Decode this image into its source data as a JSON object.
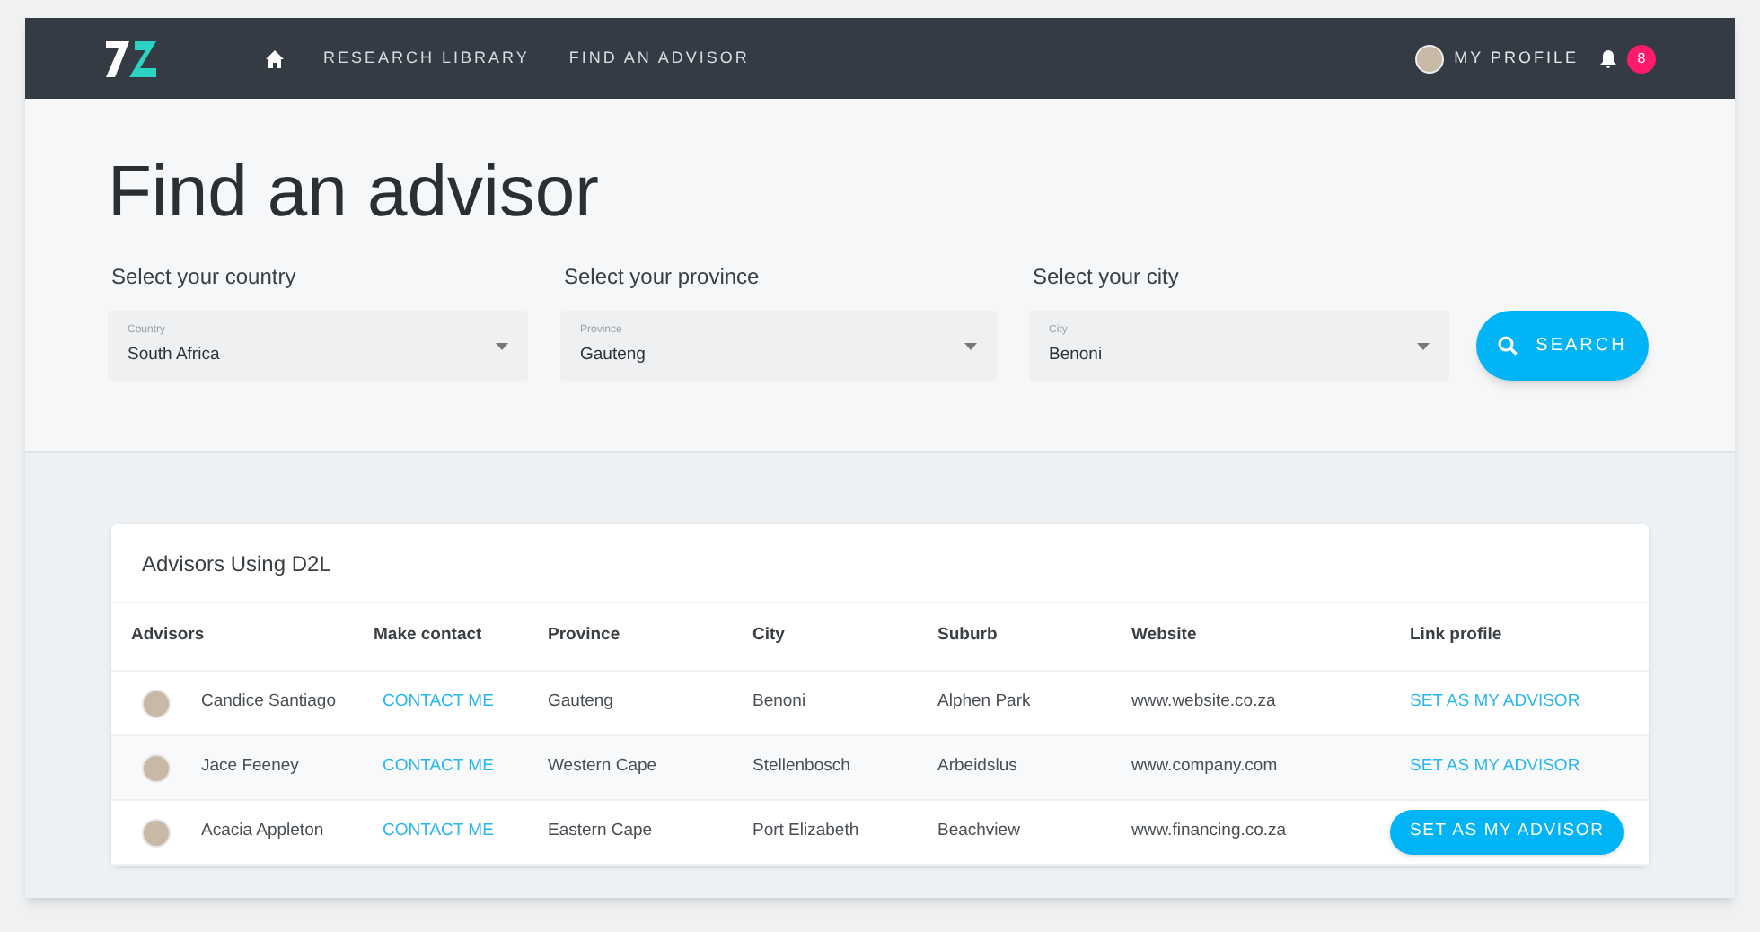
{
  "nav": {
    "links": [
      {
        "label": "RESEARCH LIBRARY",
        "selected": false
      },
      {
        "label": "FIND AN ADVISOR",
        "selected": false
      }
    ],
    "profile": "MY PROFILE",
    "notifications": "8"
  },
  "page_title": "Find an advisor",
  "filters": [
    {
      "heading": "Select your country",
      "label": "Country",
      "value": "South Africa"
    },
    {
      "heading": "Select your province",
      "label": "Province",
      "value": "Gauteng"
    },
    {
      "heading": "Select your city",
      "label": "City",
      "value": "Benoni"
    }
  ],
  "search_button": "SEARCH",
  "table": {
    "title": "Advisors Using D2L",
    "columns": [
      "Advisors",
      "Make contact",
      "Province",
      "City",
      "Suburb",
      "Website",
      "Link profile"
    ],
    "rows": [
      {
        "name": "Candice Santiago",
        "contact": "CONTACT ME",
        "province": "Gauteng",
        "city": "Benoni",
        "suburb": "Alphen Park",
        "website": "www.website.co.za",
        "link": "SET AS MY ADVISOR",
        "hovered": false
      },
      {
        "name": "Jace Feeney",
        "contact": "CONTACT ME",
        "province": "Western Cape",
        "city": "Stellenbosch",
        "suburb": "Arbeidslus",
        "website": "www.company.com",
        "link": "SET AS MY ADVISOR",
        "hovered": false
      },
      {
        "name": "Acacia Appleton",
        "contact": "CONTACT ME",
        "province": "Eastern Cape",
        "city": "Port Elizabeth",
        "suburb": "Beachview",
        "website": "www.financing.co.za",
        "link": "SET AS MY ADVISOR",
        "hovered": true
      }
    ]
  }
}
